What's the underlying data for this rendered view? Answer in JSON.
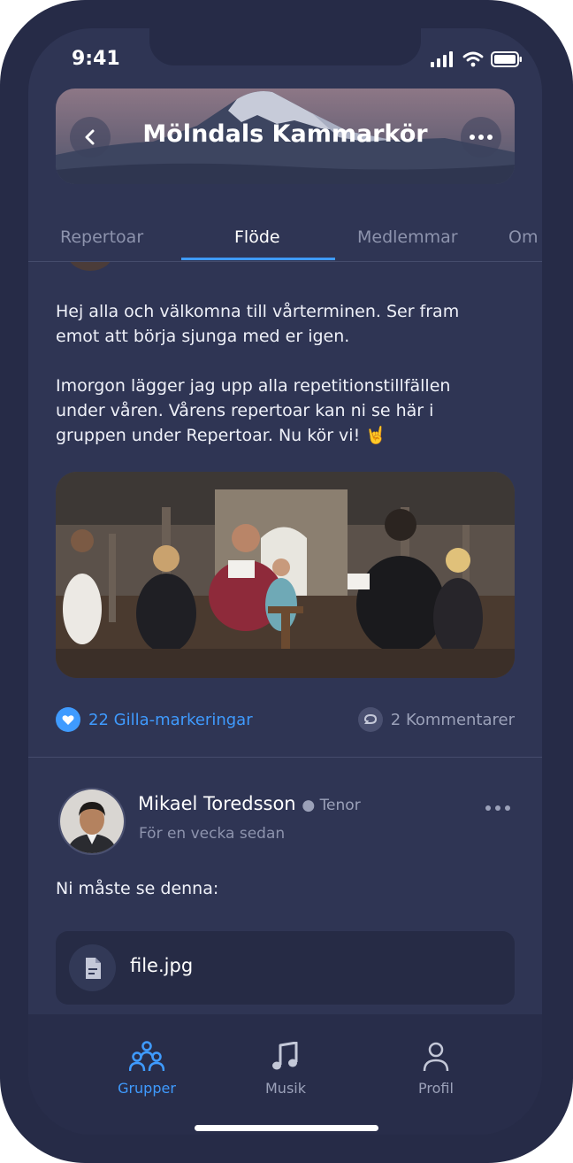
{
  "status_bar": {
    "time": "9:41"
  },
  "header": {
    "title": "Mölndals Kammarkör"
  },
  "tabs": [
    {
      "label": "Repertoar"
    },
    {
      "label": "Flöde"
    },
    {
      "label": "Medlemmar"
    },
    {
      "label": "Om"
    }
  ],
  "post1": {
    "paragraph1": "Hej alla och välkomna till vårterminen. Ser fram emot att börja sjunga med er igen.",
    "paragraph2": "Imorgon lägger jag upp alla repetitionstillfällen under våren. Vårens repertoar kan ni se här i gruppen under Repertoar. Nu kör vi! 🤘",
    "likes": "22 Gilla-markeringar",
    "comments": "2 Kommentarer"
  },
  "post2": {
    "author": "Mikael Toredsson",
    "role": "Tenor",
    "time_ago": "För en vecka sedan",
    "text": "Ni måste se denna:",
    "file_name": "file.jpg"
  },
  "bottom_nav": [
    {
      "label": "Grupper"
    },
    {
      "label": "Musik"
    },
    {
      "label": "Profil"
    }
  ],
  "colors": {
    "accent": "#3f9bff",
    "background": "#2f3554",
    "nav_bg": "#282d4a"
  }
}
